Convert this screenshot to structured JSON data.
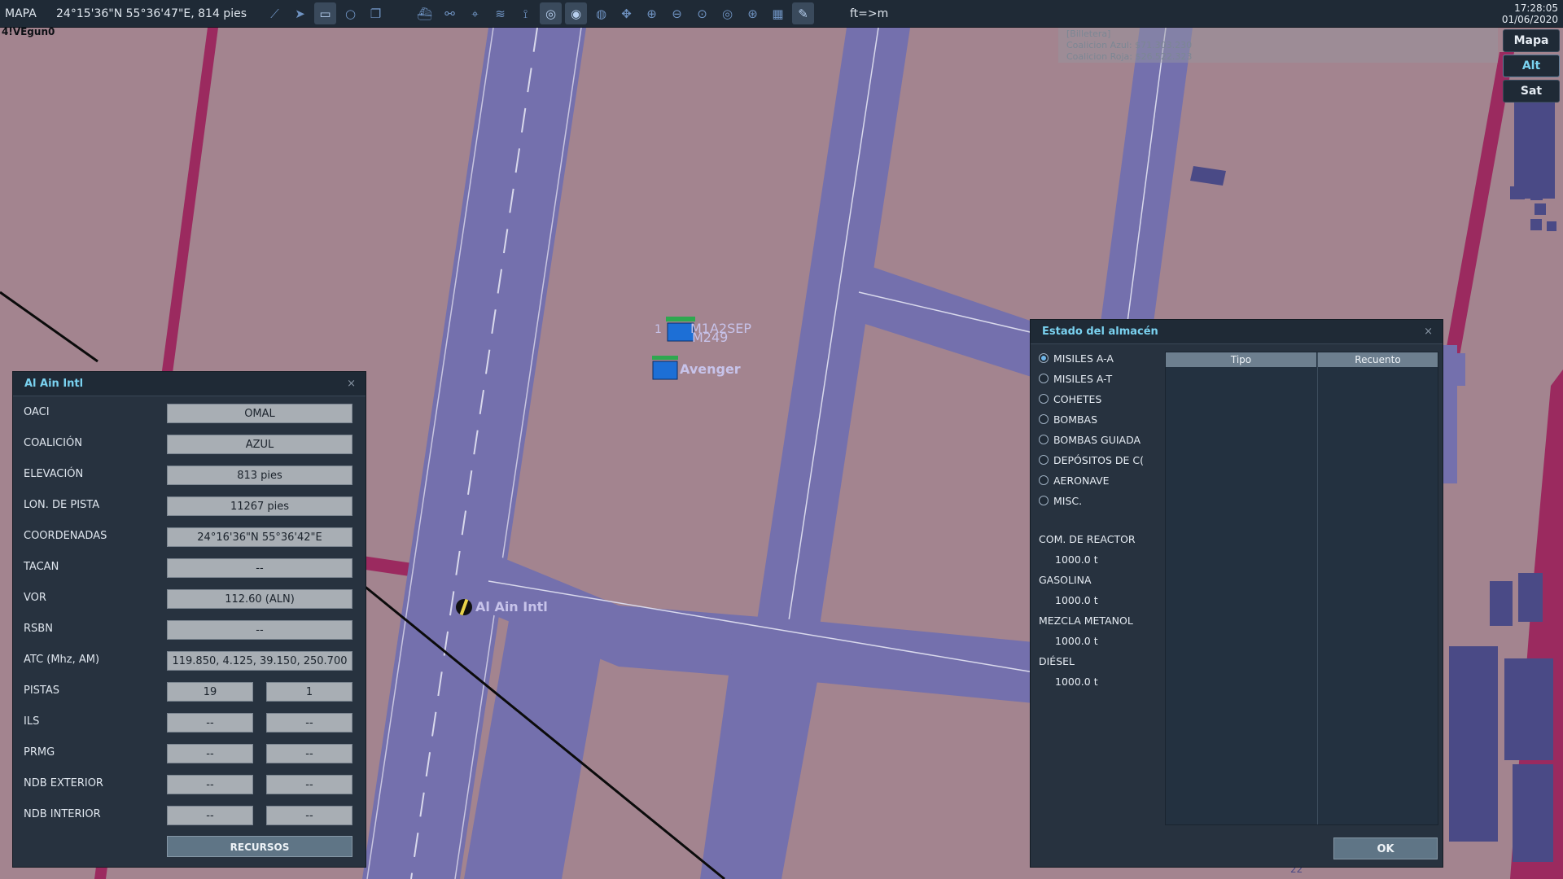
{
  "topbar": {
    "mode": "MAPA",
    "cursor_coords": "24°15'36\"N 55°36'47\"E, 814 pies",
    "unit_toggle": "ft=>m",
    "time": "17:28:05",
    "date": "01/06/2020",
    "tools_left": [
      "route-icon",
      "navigate-icon",
      "ruler-icon",
      "circle-icon",
      "layers-icon"
    ],
    "tools_right": [
      "ship-icon",
      "network-icon",
      "crosshair-icon",
      "wifi-icon",
      "antenna-icon",
      "radar-alt-icon",
      "radar-icon",
      "radar-range-icon",
      "pan-icon",
      "zoom-in-icon",
      "zoom-out-icon",
      "zoom-fit-icon",
      "target-icon",
      "globe-icon",
      "grid-icon",
      "pencil-icon"
    ]
  },
  "corner_tag": "4!VEgun0",
  "wallet": {
    "title": "[Billetera]",
    "blue": "Coalicion Azul: $71.303.230",
    "red": "Coalicion Roja: $26.522.323"
  },
  "map_type": {
    "options": [
      "Mapa",
      "Alt",
      "Sat"
    ],
    "selected": "Alt"
  },
  "map": {
    "units": [
      "M1A2SEP",
      "M249",
      "Avenger"
    ],
    "unit_count": "1",
    "airfield_label": "Al Ain Intl",
    "runway_number": "22"
  },
  "airbase_panel": {
    "title": "Al Ain Intl",
    "close": "×",
    "rows": [
      {
        "label": "OACI",
        "value": "OMAL"
      },
      {
        "label": "COALICIÓN",
        "value": "AZUL"
      },
      {
        "label": "ELEVACIÓN",
        "value": "813 pies"
      },
      {
        "label": "LON. DE PISTA",
        "value": "11267 pies"
      },
      {
        "label": "COORDENADAS",
        "value": "24°16'36\"N 55°36'42\"E"
      },
      {
        "label": "TACAN",
        "value": "--"
      },
      {
        "label": "VOR",
        "value": "112.60 (ALN)"
      },
      {
        "label": "RSBN",
        "value": "--"
      },
      {
        "label": "ATC  (Mhz, AM)",
        "value": "119.850, 4.125, 39.150, 250.700"
      }
    ],
    "pair_rows": [
      {
        "label": "PISTAS",
        "a": "19",
        "b": "1"
      },
      {
        "label": "ILS",
        "a": "--",
        "b": "--"
      },
      {
        "label": "PRMG",
        "a": "--",
        "b": "--"
      },
      {
        "label": "NDB EXTERIOR",
        "a": "--",
        "b": "--"
      },
      {
        "label": "NDB INTERIOR",
        "a": "--",
        "b": "--"
      }
    ],
    "resources_button": "RECURSOS"
  },
  "warehouse_panel": {
    "title": "Estado del almacén",
    "close": "×",
    "categories": [
      "MISILES A-A",
      "MISILES A-T",
      "COHETES",
      "BOMBAS",
      "BOMBAS GUIADA",
      "DEPÓSITOS DE C(",
      "AERONAVE",
      "MISC."
    ],
    "selected_category": "MISILES A-A",
    "fuels": [
      {
        "label": "COM. DE REACTOR",
        "value": "1000.0 t"
      },
      {
        "label": "GASOLINA",
        "value": "1000.0 t"
      },
      {
        "label": "MEZCLA METANOL",
        "value": "1000.0 t"
      },
      {
        "label": "DIÉSEL",
        "value": "1000.0 t"
      }
    ],
    "table_headers": [
      "Tipo",
      "Recuento"
    ],
    "ok_button": "OK"
  },
  "colors": {
    "ground": "#a3848f",
    "taxiway": "#7470ad",
    "road": "#9b2a5f",
    "panel_bg": "#27323f",
    "accent": "#7ad2f0",
    "unit_blue": "#1d6fd6"
  }
}
